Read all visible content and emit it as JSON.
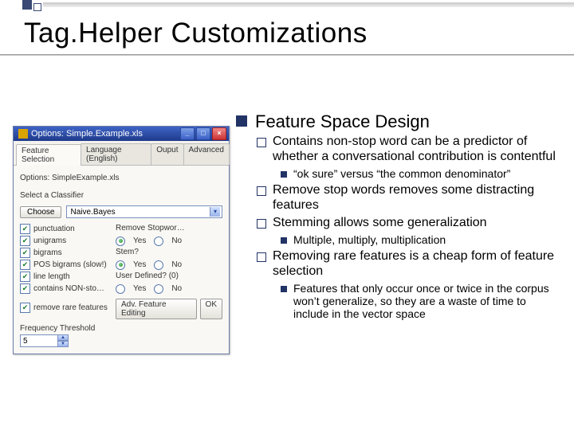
{
  "slide": {
    "title": "Tag.Helper Customizations"
  },
  "window": {
    "title": "Options: Simple.Example.xls",
    "tabs": [
      "Feature Selection",
      "Language (English)",
      "Ouput",
      "Advanced"
    ],
    "options_label": "Options: SimpleExample.xls",
    "select_label": "Select a Classifier",
    "choose_btn": "Choose",
    "classifier": "Naive.Bayes",
    "left_checks": [
      {
        "label": "punctuation",
        "checked": true
      },
      {
        "label": "unigrams",
        "checked": true
      },
      {
        "label": "bigrams",
        "checked": true
      },
      {
        "label": "POS bigrams (slow!)",
        "checked": true
      },
      {
        "label": "line length",
        "checked": true
      },
      {
        "label": "contains NON-sto…",
        "checked": true
      },
      {
        "label": "remove rare features",
        "checked": true
      }
    ],
    "right_qs": [
      {
        "label": "Remove Stopwor…",
        "value": "yes"
      },
      {
        "label": "Stem?",
        "value": "no"
      },
      {
        "label": "User Defined? (0)",
        "value": "none"
      }
    ],
    "yes": "Yes",
    "no": "No",
    "adv_btn": "Adv. Feature Editing",
    "ok_btn": "OK",
    "freq_label": "Frequency Threshold",
    "freq_value": "5"
  },
  "bullets": {
    "l1": "Feature Space Design",
    "l2a": "Contains non-stop word can be a predictor of whether a conversational contribution is contentful",
    "l3a": "“ok sure” versus “the common denominator”",
    "l2b": "Remove stop words removes some distracting features",
    "l2c": "Stemming allows some generalization",
    "l3b": "Multiple, multiply, multiplication",
    "l2d": "Removing rare features is a cheap form of feature selection",
    "l3c": "Features that only occur once or twice in the corpus won’t generalize, so they are a waste of time to include in the vector space"
  }
}
